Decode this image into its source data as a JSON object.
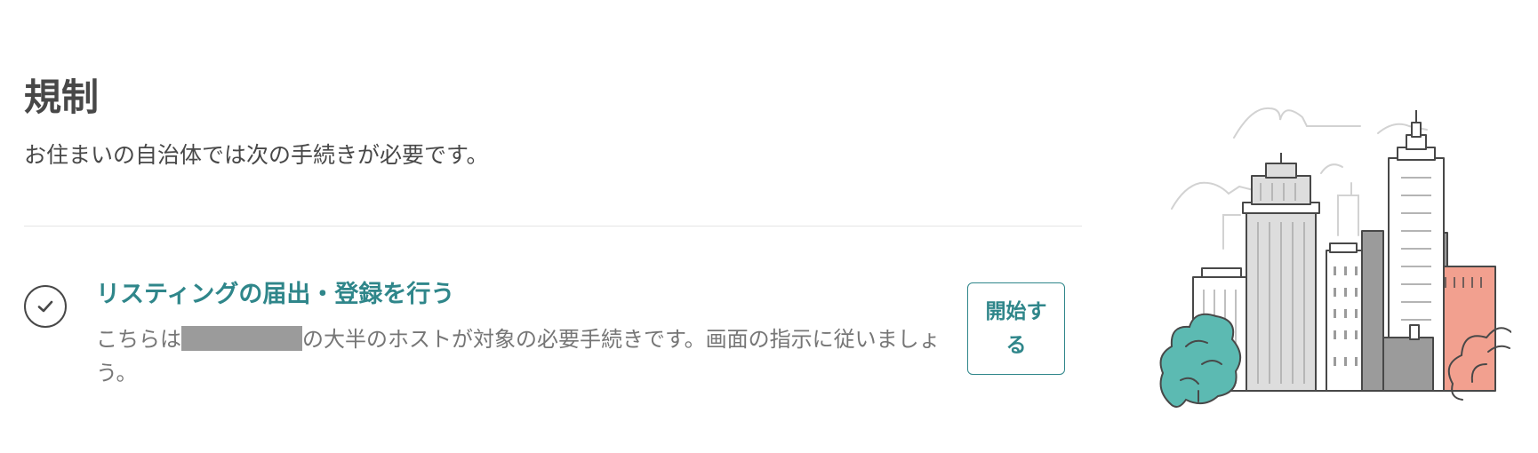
{
  "section": {
    "title": "規制",
    "subtitle": "お住まいの自治体では次の手続きが必要です。"
  },
  "task": {
    "title": "リスティングの届出・登録を行う",
    "description_before": "こちらは",
    "description_after": "の大半のホストが対象の必要手続きです。画面の指示に従いましょう。",
    "status_icon": "checkmark-icon",
    "button_label": "開始する"
  },
  "illustration": {
    "name": "city-skyline-illustration"
  },
  "colors": {
    "accent": "#2f868a",
    "text": "#484848",
    "muted_text": "#767676",
    "tree": "#5cbab2",
    "brick": "#f2a08f",
    "building_gray": "#9b9b9b",
    "divider": "#e4e4e4"
  }
}
